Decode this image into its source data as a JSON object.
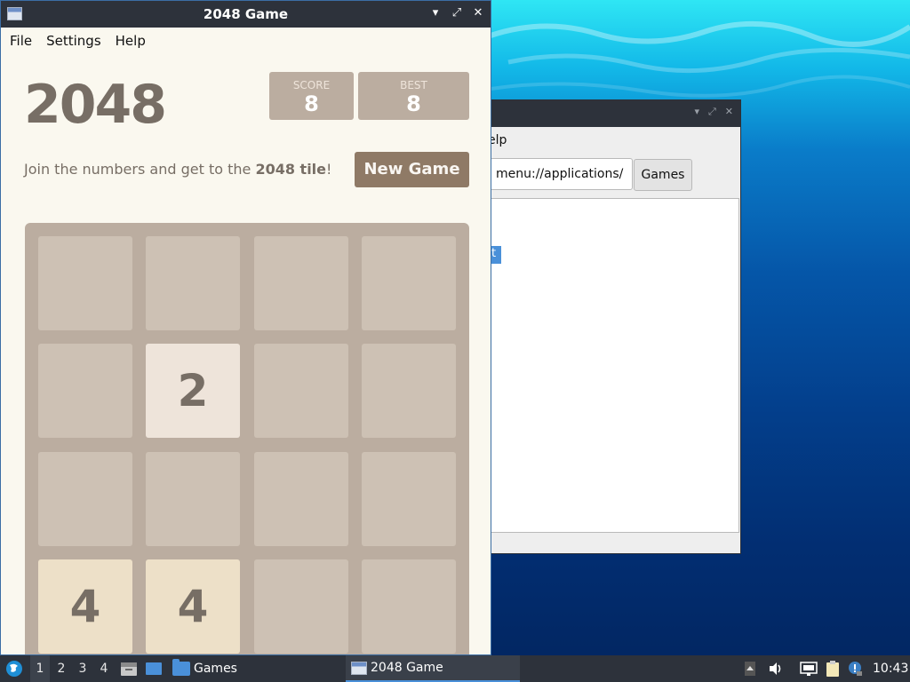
{
  "game_window": {
    "title": "2048 Game",
    "controls": {
      "minimize": "▾",
      "maximize": "⤢",
      "close": "✕"
    },
    "menu": [
      "File",
      "Settings",
      "Help"
    ],
    "heading": "2048",
    "score_label": "SCORE",
    "score_value": "8",
    "best_label": "BEST",
    "best_value": "8",
    "subtitle_prefix": "Join the numbers and get to the ",
    "subtitle_bold": "2048 tile",
    "subtitle_suffix": "!",
    "new_game_label": "New Game",
    "board": [
      [
        "",
        "",
        "",
        ""
      ],
      [
        "",
        "2",
        "",
        ""
      ],
      [
        "",
        "",
        "",
        ""
      ],
      [
        "4",
        "4",
        "",
        ""
      ]
    ]
  },
  "file_manager": {
    "menu_partial": "elp",
    "path": "menu://applications/",
    "crumb_button": "Games",
    "selected_partial": "t"
  },
  "taskbar": {
    "workspaces": [
      "1",
      "2",
      "3",
      "4"
    ],
    "active_workspace": "1",
    "games_label": "Games",
    "task_label": "2048 Game",
    "clock": "10:43"
  },
  "colors": {
    "accent": "#4a90d9",
    "tile_empty": "#cdc1b4",
    "board": "#bbada0",
    "tile_2": "#eee4da",
    "tile_4": "#ede0c8",
    "new_game_button": "#8f7a66"
  }
}
